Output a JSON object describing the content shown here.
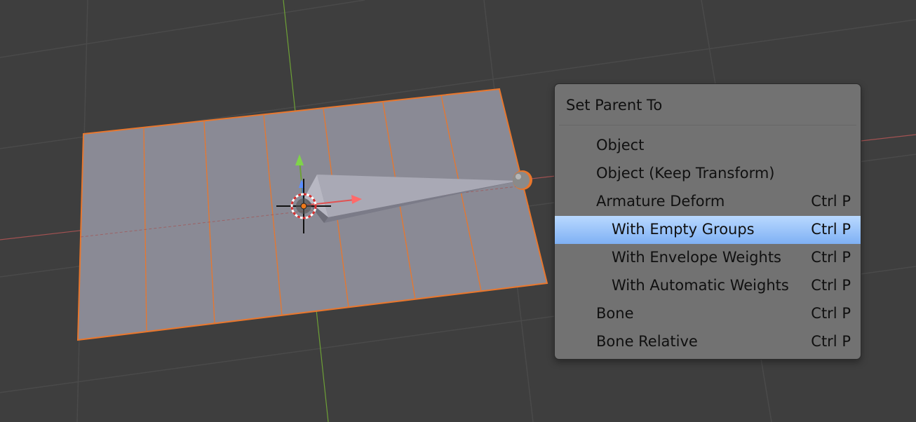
{
  "menu": {
    "title": "Set Parent To",
    "items": [
      {
        "label": "Object",
        "shortcut": ""
      },
      {
        "label": "Object (Keep Transform)",
        "shortcut": ""
      },
      {
        "label": "Armature Deform",
        "shortcut": "Ctrl P"
      },
      {
        "label": "With Empty Groups",
        "shortcut": "Ctrl P"
      },
      {
        "label": "With Envelope Weights",
        "shortcut": "Ctrl P"
      },
      {
        "label": "With Automatic Weights",
        "shortcut": "Ctrl P"
      },
      {
        "label": "Bone",
        "shortcut": "Ctrl P"
      },
      {
        "label": "Bone Relative",
        "shortcut": "Ctrl P"
      }
    ],
    "active_item": "With Empty Groups"
  },
  "colors": {
    "viewport_bg": "#3e3e3e",
    "grid_line": "#4a4a4a",
    "plane_fill": "#8a8a95",
    "selection_outline": "#e8772e",
    "x_axis": "#a35252",
    "y_axis": "#6da036",
    "menu_bg": "#727272",
    "menu_highlight": "#7fb1f4"
  }
}
